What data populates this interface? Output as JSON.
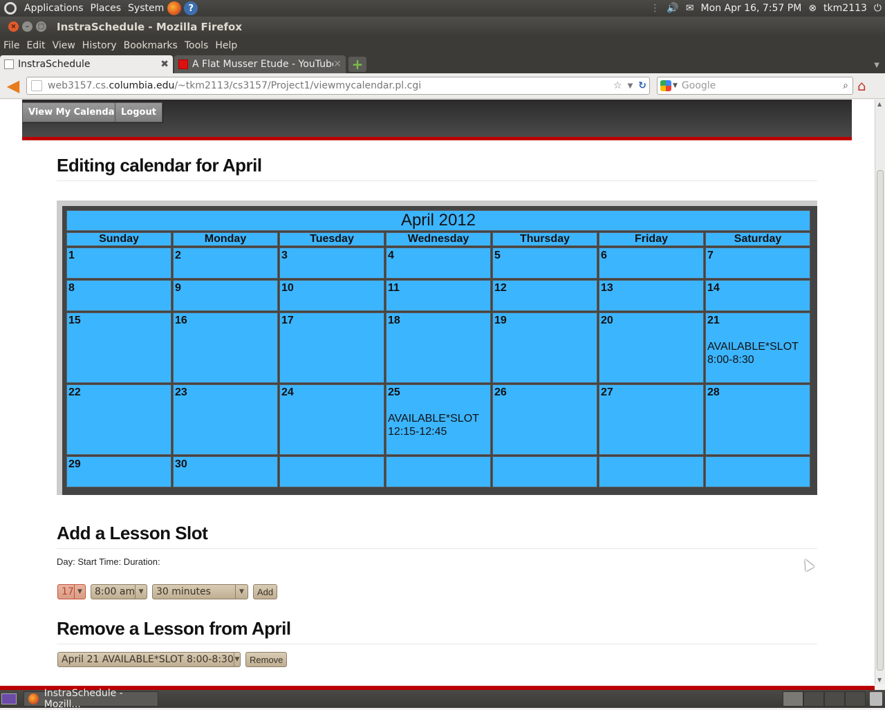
{
  "top_panel": {
    "applications": "Applications",
    "places": "Places",
    "system": "System",
    "datetime": "Mon Apr 16,  7:57 PM",
    "user": "tkm2113"
  },
  "window": {
    "title": "InstraSchedule - Mozilla Firefox"
  },
  "menubar": {
    "file": "File",
    "edit": "Edit",
    "view": "View",
    "history": "History",
    "bookmarks": "Bookmarks",
    "tools": "Tools",
    "help": "Help"
  },
  "tabs": [
    {
      "label": "InstraSchedule",
      "active": true
    },
    {
      "label": "A Flat Musser Etude - YouTube",
      "active": false
    }
  ],
  "navbar": {
    "url_prefix": "web3157.cs.",
    "url_domain": "columbia.edu",
    "url_path": "/~tkm2113/cs3157/Project1/viewmycalendar.pl.cgi",
    "search_placeholder": "Google"
  },
  "site_nav": {
    "view_calendar": "View My Calendar",
    "logout": "Logout"
  },
  "headings": {
    "editing": "Editing calendar for April",
    "add": "Add a Lesson Slot",
    "remove": "Remove a Lesson from April"
  },
  "calendar": {
    "month_title": "April 2012",
    "weekdays": [
      "Sunday",
      "Monday",
      "Tuesday",
      "Wednesday",
      "Thursday",
      "Friday",
      "Saturday"
    ],
    "weeks": [
      [
        {
          "day": "1"
        },
        {
          "day": "2"
        },
        {
          "day": "3"
        },
        {
          "day": "4"
        },
        {
          "day": "5"
        },
        {
          "day": "6"
        },
        {
          "day": "7"
        }
      ],
      [
        {
          "day": "8"
        },
        {
          "day": "9"
        },
        {
          "day": "10"
        },
        {
          "day": "11"
        },
        {
          "day": "12"
        },
        {
          "day": "13"
        },
        {
          "day": "14"
        }
      ],
      [
        {
          "day": "15"
        },
        {
          "day": "16"
        },
        {
          "day": "17"
        },
        {
          "day": "18"
        },
        {
          "day": "19"
        },
        {
          "day": "20"
        },
        {
          "day": "21",
          "slot1": "AVAILABLE*SLOT",
          "slot2": "8:00-8:30"
        }
      ],
      [
        {
          "day": "22"
        },
        {
          "day": "23"
        },
        {
          "day": "24"
        },
        {
          "day": "25",
          "slot1": "AVAILABLE*SLOT",
          "slot2": "12:15-12:45"
        },
        {
          "day": "26"
        },
        {
          "day": "27"
        },
        {
          "day": "28"
        }
      ],
      [
        {
          "day": "29"
        },
        {
          "day": "30"
        },
        {
          "day": ""
        },
        {
          "day": ""
        },
        {
          "day": ""
        },
        {
          "day": ""
        },
        {
          "day": ""
        }
      ]
    ]
  },
  "add_form": {
    "labels": "Day: Start Time: Duration:",
    "day_value": "17",
    "time_value": "8:00 am",
    "duration_value": "30 minutes",
    "add_label": "Add"
  },
  "remove_form": {
    "lesson_value": "April 21 AVAILABLE*SLOT 8:00-8:30",
    "remove_label": "Remove"
  },
  "taskbar": {
    "task_label": "InstraSchedule - Mozill..."
  },
  "colors": {
    "calendar_cell": "#3cb5ff",
    "header_band": "#bb0000"
  }
}
